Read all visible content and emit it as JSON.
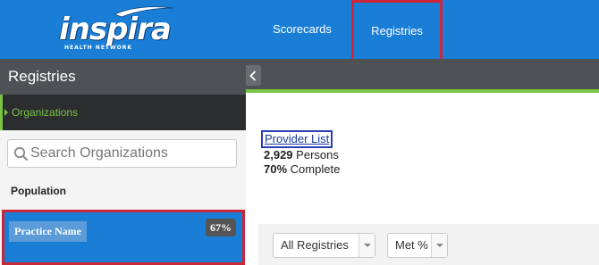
{
  "header": {
    "logo": {
      "word": "inspira",
      "tagline": "HEALTH NETWORK"
    },
    "nav": [
      {
        "label": "Scorecards"
      },
      {
        "label": "Registries"
      }
    ]
  },
  "sidebar": {
    "title": "Registries",
    "org_item": "Organizations",
    "search": {
      "placeholder": "Search Organizations",
      "value": ""
    },
    "section_label": "Population",
    "practice": {
      "label": "Practice Name",
      "badge": "67%"
    }
  },
  "main": {
    "provider_link": "Provider List",
    "persons": {
      "count": "2,929",
      "unit": "Persons"
    },
    "complete": {
      "value": "70%",
      "unit": "Complete"
    },
    "filters": [
      {
        "label": "All Registries"
      },
      {
        "label": "Met %"
      }
    ]
  },
  "colors": {
    "brand_blue": "#1a7ed6",
    "accent_green": "#79c443",
    "highlight_red": "#d0263a",
    "link_blue": "#1a3a9c"
  },
  "icons": [
    "search-icon",
    "chevron-left-icon",
    "chevron-down-icon"
  ]
}
